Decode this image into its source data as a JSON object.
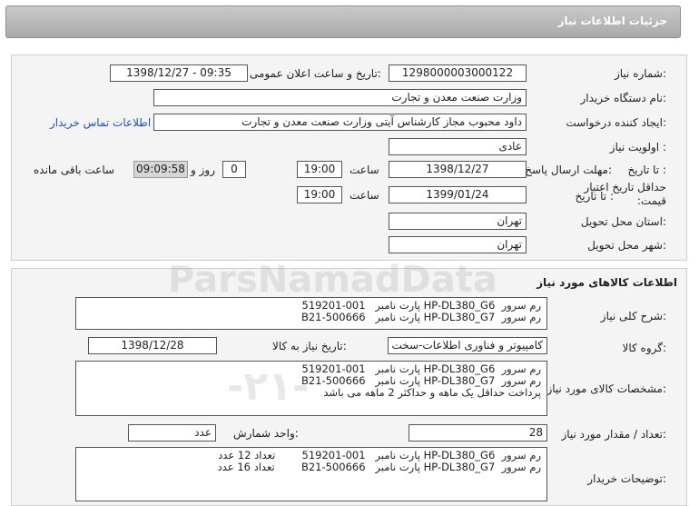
{
  "header": {
    "title": "جزئیات اطلاعات نیاز"
  },
  "info": {
    "need_number_label": "شماره نیاز:",
    "need_number": "1298000003000122",
    "announce_label": "تاریخ و ساعت اعلان عمومی:",
    "announce_value": "1398/12/27 - 09:35",
    "buyer_org_label": "نام دستگاه خریدار:",
    "buyer_org": "وزارت صنعت معدن و تجارت",
    "creator_label": "ایجاد کننده درخواست:",
    "creator": "داود محبوب مجاز کارشناس آیتی وزارت صنعت معدن و تجارت",
    "contact_link": "اطلاعات تماس خریدار",
    "priority_label": "اولویت نیاز :",
    "priority": "عادی",
    "deadline_label": "مهلت ارسال پاسخ:",
    "to_date_label": "تا تاریخ :",
    "deadline_date": "1398/12/27",
    "time_label": "ساعت",
    "deadline_time": "19:00",
    "days_value": "0",
    "days_label": "روز و",
    "remaining_value": "09:09:58",
    "remaining_label": "ساعت باقی مانده",
    "validity_label": "حداقل تاریخ اعتبار قیمت:",
    "validity_to_label": "تا تاریخ :",
    "validity_date": "1399/01/24",
    "validity_time_label": "ساعت",
    "validity_time": "19:00",
    "province_label": "استان محل تحویل:",
    "province": "تهران",
    "city_label": "شهر محل تحویل:",
    "city": "تهران"
  },
  "goods": {
    "title": "اطلاعات کالاهای مورد نیاز",
    "summary_label": "شرح کلی نیاز:",
    "summary": "رم سرور  HP-DL380_G6 پارت نامبر   001-519201\nرم سرور  HP-DL380_G7 پارت نامبر   B21-500666",
    "group_label": "گروه کالا:",
    "group": "کامپیوتر و فناوری اطلاعات-سخت افزار",
    "need_date_label": "تاریخ نیاز به کالا:",
    "need_date": "1398/12/28",
    "specs_label": "مشخصات کالای مورد نیاز:",
    "specs": "رم سرور  HP-DL380_G6 پارت نامبر   001-519201\nرم سرور  HP-DL380_G7 پارت نامبر   B21-500666\nپرداخت حداقل یک ماهه و حداکثر 2 ماهه می باشد",
    "qty_label": "تعداد / مقدار مورد نیاز:",
    "qty": "28",
    "unit_label": "واحد شمارش:",
    "unit": "عدد",
    "buyer_notes_label": "توضیحات خریدار:",
    "buyer_notes": "رم سرور  HP-DL380_G6 پارت نامبر   001-519201        تعداد 12 عدد\nرم سرور  HP-DL380_G7 پارت نامبر   B21-500666        تعداد 16 عدد"
  }
}
